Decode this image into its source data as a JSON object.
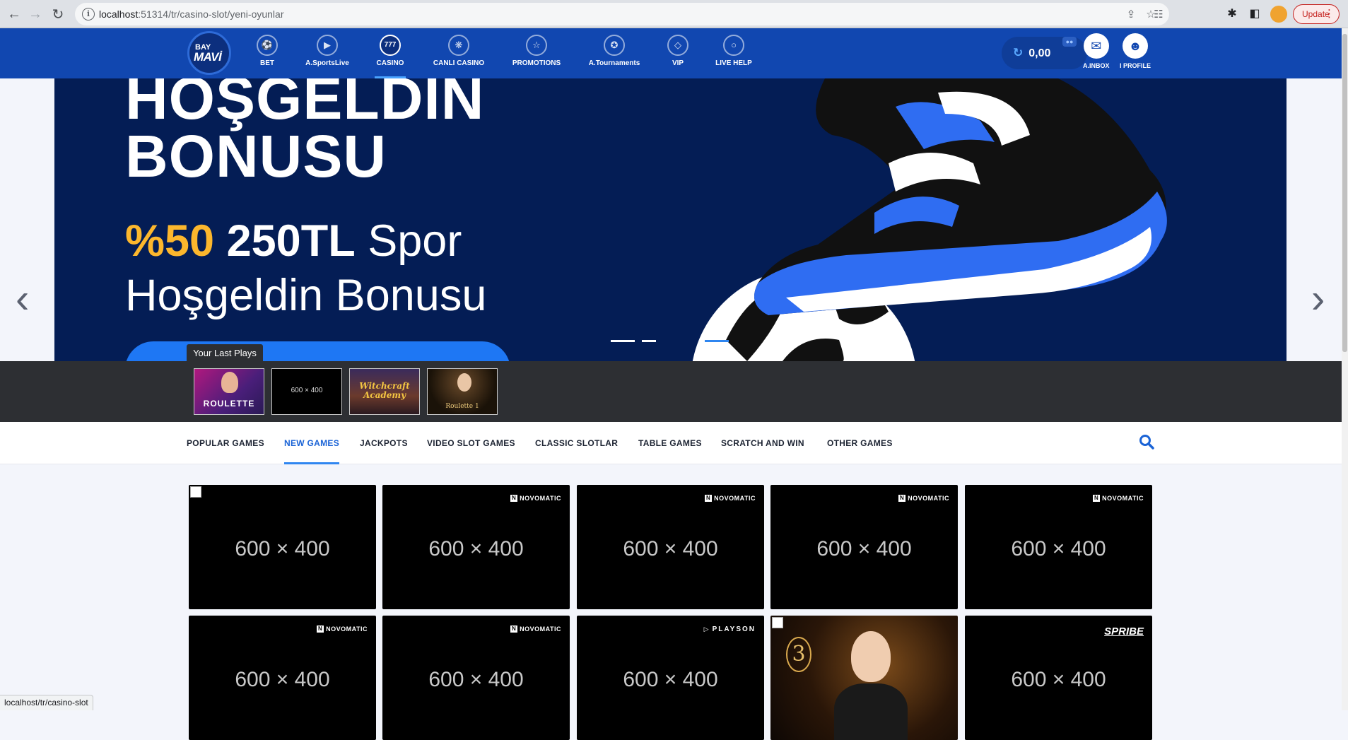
{
  "browser": {
    "url_host": "localhost",
    "url_path": ":51314/tr/casino-slot/yeni-oyunlar",
    "update_label": "Update",
    "status_url": "localhost/tr/casino-slot"
  },
  "site": {
    "logo_top": "BAY",
    "logo_main": "MAVİ",
    "nav": [
      {
        "label": "BET",
        "icon": "ball-icon"
      },
      {
        "label": "A.SportsLive",
        "icon": "play-icon"
      },
      {
        "label": "CASINO",
        "icon": "777-icon",
        "glyph": "777"
      },
      {
        "label": "CANLI CASINO",
        "icon": "chip-icon"
      },
      {
        "label": "PROMOTIONS",
        "icon": "star-icon"
      },
      {
        "label": "A.Tournaments",
        "icon": "trophy-icon"
      },
      {
        "label": "VIP",
        "icon": "diamond-icon"
      },
      {
        "label": "LIVE HELP",
        "icon": "chat-icon"
      }
    ],
    "balance": "0,00",
    "inbox_label": "A.INBOX",
    "profile_label": "I PROFILE"
  },
  "hero": {
    "title_line1": "HOŞGELDİN",
    "title_line2": "BONUSU",
    "percent": "%50",
    "amount": "250TL",
    "sub_tail": "Spor",
    "sub_line2": "Hoşgeldin Bonusu"
  },
  "last_plays": {
    "title": "Your Last Plays",
    "items": [
      {
        "label": "ROULETTE",
        "kind": "roulette"
      },
      {
        "label": "600 × 400",
        "kind": "placeholder"
      },
      {
        "label": "Witchcraft Academy",
        "kind": "witchcraft"
      },
      {
        "label": "Roulette 1",
        "kind": "roulette1"
      }
    ]
  },
  "categories": [
    {
      "label": "POPULAR GAMES",
      "active": false
    },
    {
      "label": "NEW GAMES",
      "active": true
    },
    {
      "label": "JACKPOTS",
      "active": false
    },
    {
      "label": "VIDEO SLOT GAMES",
      "active": false
    },
    {
      "label": "CLASSIC SLOTLAR",
      "active": false
    },
    {
      "label": "TABLE GAMES",
      "active": false
    },
    {
      "label": "SCRATCH AND WIN",
      "active": false
    },
    {
      "label": "OTHER GAMES",
      "active": false
    }
  ],
  "games": [
    {
      "placeholder": "600 × 400",
      "provider": ""
    },
    {
      "placeholder": "600 × 400",
      "provider": "NOVOMATIC"
    },
    {
      "placeholder": "600 × 400",
      "provider": "NOVOMATIC"
    },
    {
      "placeholder": "600 × 400",
      "provider": "NOVOMATIC"
    },
    {
      "placeholder": "600 × 400",
      "provider": "NOVOMATIC"
    },
    {
      "placeholder": "600 × 400",
      "provider": "NOVOMATIC"
    },
    {
      "placeholder": "600 × 400",
      "provider": "NOVOMATIC"
    },
    {
      "placeholder": "600 × 400",
      "provider": "PLAYSON"
    },
    {
      "placeholder": "",
      "provider": ""
    },
    {
      "placeholder": "600 × 400",
      "provider": "SPRIBE"
    }
  ],
  "colors": {
    "header_blue": "#1147b0",
    "hero_navy": "#041d55",
    "accent_yellow": "#fcb72d",
    "active_tab": "#1a63d6"
  }
}
